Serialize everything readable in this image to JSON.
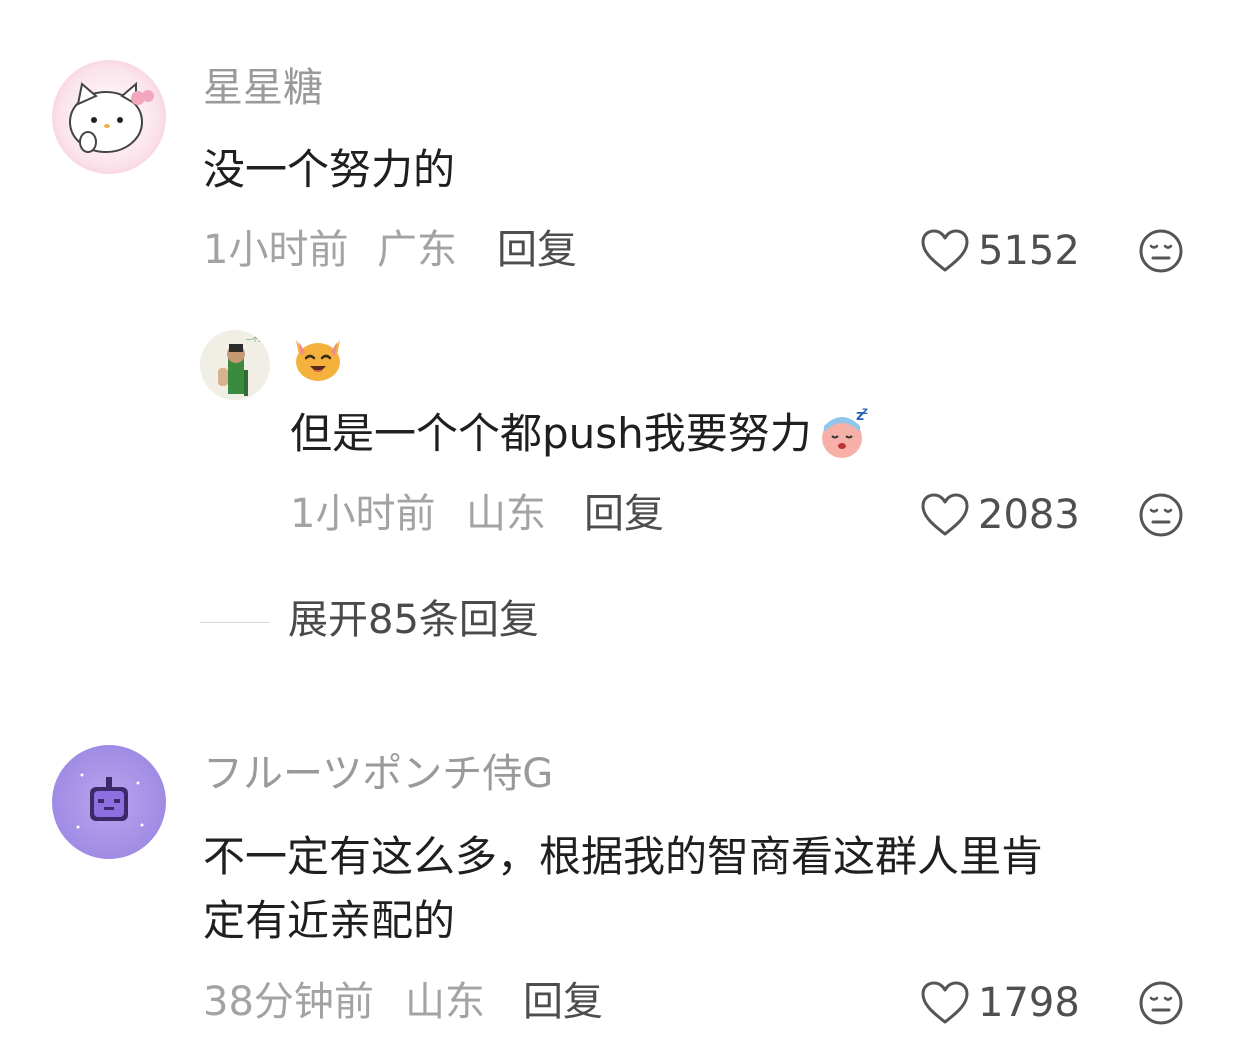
{
  "comments": [
    {
      "username": "星星糖",
      "content": "没一个努力的",
      "time": "1小时前",
      "location": "广东",
      "reply_label": "回复",
      "likes": "5152",
      "replies": [
        {
          "username_emoji": "cat-face-icon",
          "content": "但是一个个都push我要努力",
          "content_emoji": "sleeping-face-icon",
          "time": "1小时前",
          "location": "山东",
          "reply_label": "回复",
          "likes": "2083"
        }
      ],
      "expand_label": "展开85条回复"
    },
    {
      "username": "フルーツポンチ侍G",
      "content_line1": "不一定有这么多，根据我的智商看这群人里肯",
      "content_line2": "定有近亲配的",
      "time": "38分钟前",
      "location": "山东",
      "reply_label": "回复",
      "likes": "1798"
    }
  ],
  "colors": {
    "username": "#9a9a9a",
    "meta": "#a3a3a3",
    "reply": "#4d4d4d",
    "content": "#1f1f1f"
  }
}
